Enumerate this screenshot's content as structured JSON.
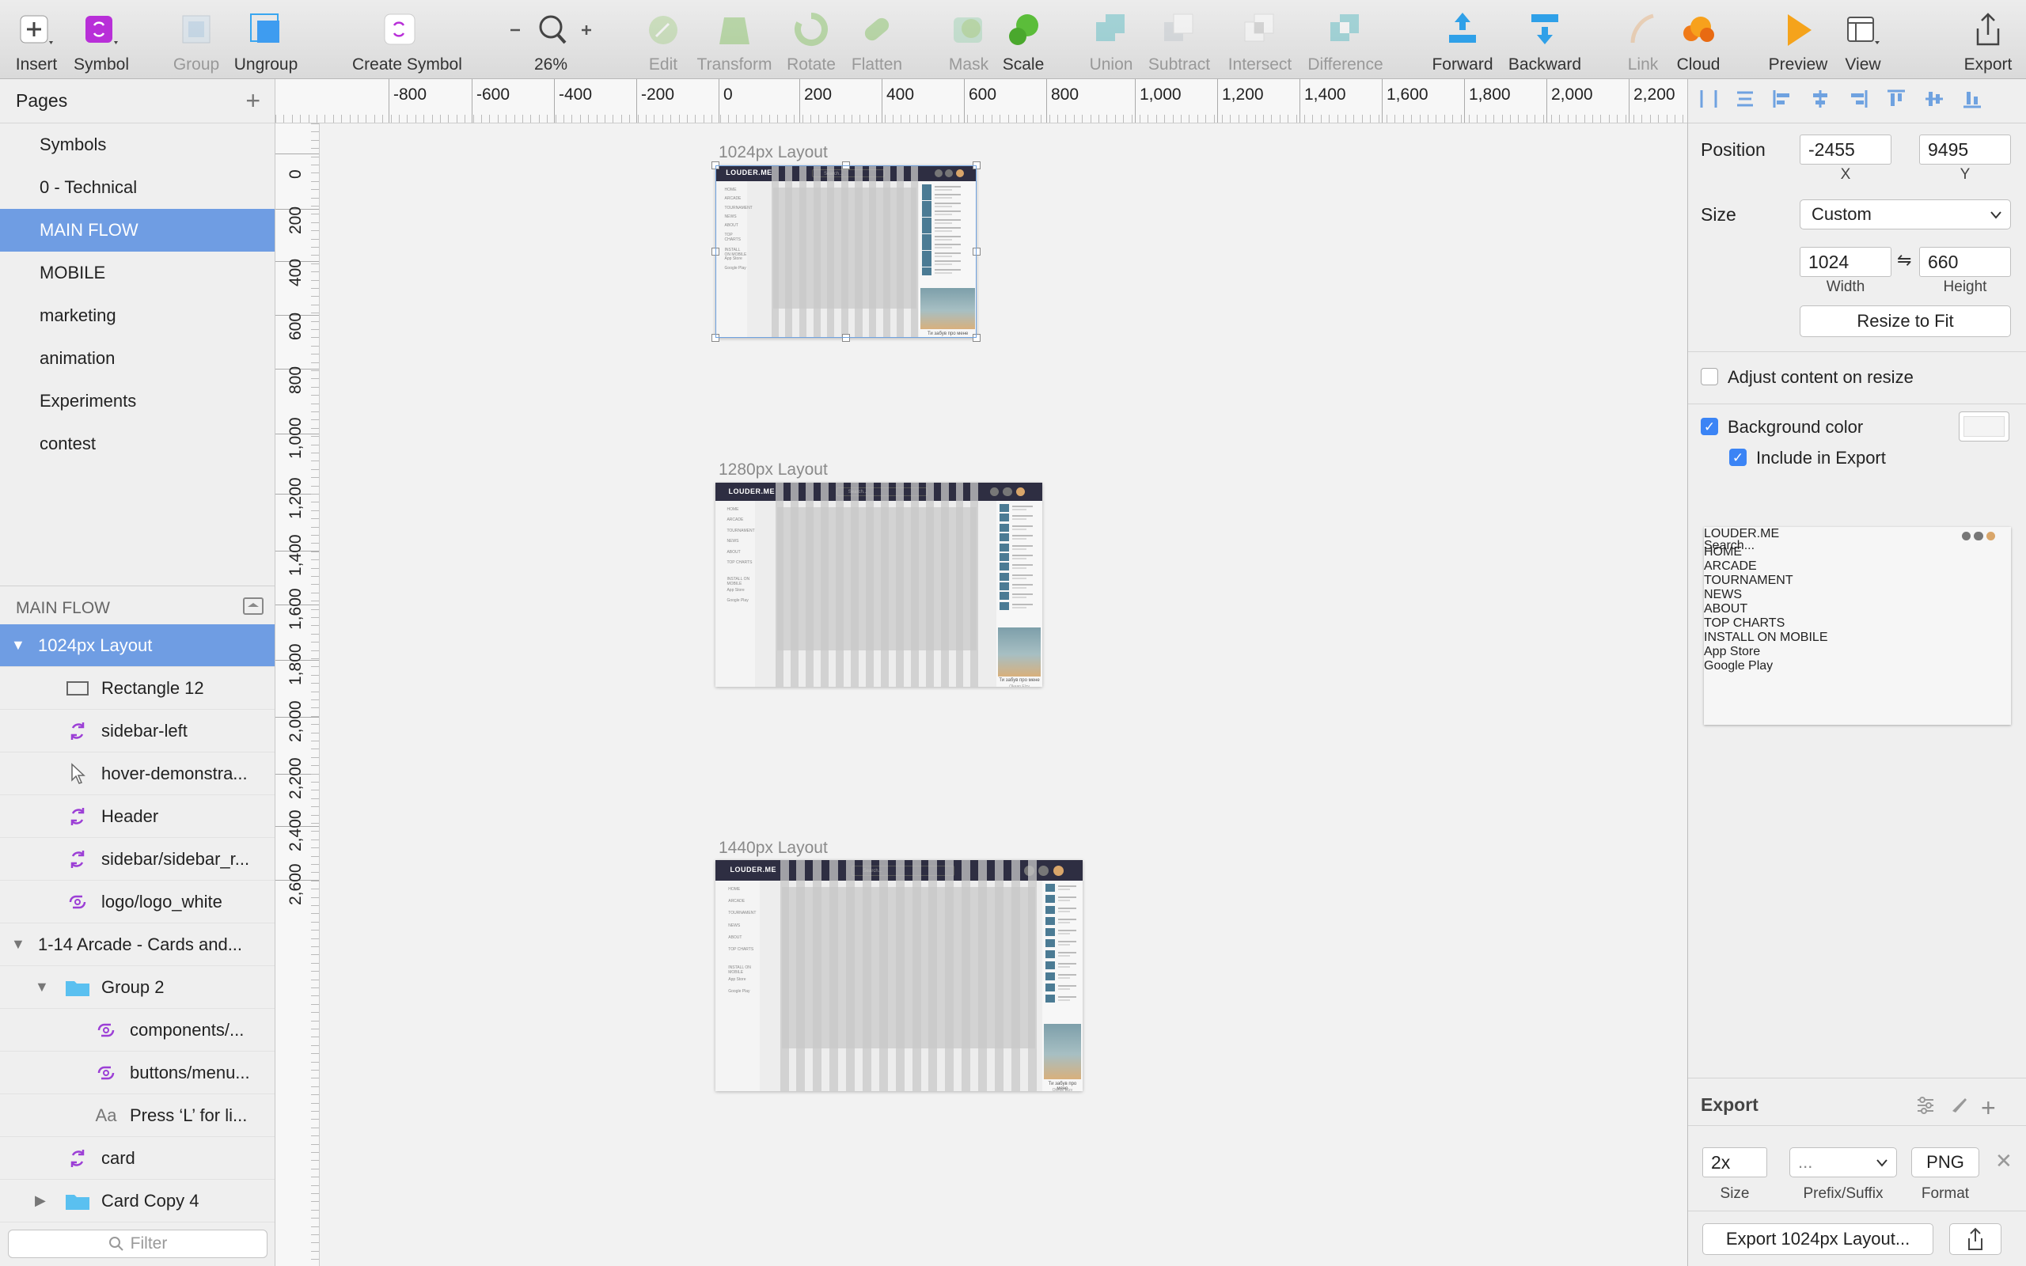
{
  "toolbar": {
    "insert": "Insert",
    "symbol": "Symbol",
    "group": "Group",
    "ungroup": "Ungroup",
    "create_symbol": "Create Symbol",
    "zoom": "26%",
    "edit": "Edit",
    "transform": "Transform",
    "rotate": "Rotate",
    "flatten": "Flatten",
    "mask": "Mask",
    "scale": "Scale",
    "union": "Union",
    "subtract": "Subtract",
    "intersect": "Intersect",
    "difference": "Difference",
    "forward": "Forward",
    "backward": "Backward",
    "link": "Link",
    "cloud": "Cloud",
    "preview": "Preview",
    "view": "View",
    "export": "Export"
  },
  "pages": {
    "title": "Pages",
    "items": [
      "Symbols",
      "0 - Technical",
      "MAIN FLOW",
      "MOBILE",
      "marketing",
      "animation",
      "Experiments",
      "contest"
    ],
    "selected": "MAIN FLOW"
  },
  "layers": {
    "title": "MAIN FLOW",
    "items": [
      {
        "label": "1024px Layout",
        "icon": "artboard-triangle-icon",
        "selected": true
      },
      {
        "label": "Rectangle 12",
        "icon": "rectangle-icon"
      },
      {
        "label": "sidebar-left",
        "icon": "symbol-instance-icon"
      },
      {
        "label": "hover-demonstra...",
        "icon": "cursor-icon"
      },
      {
        "label": "Header",
        "icon": "symbol-instance-icon"
      },
      {
        "label": "sidebar/sidebar_r...",
        "icon": "symbol-instance-icon"
      },
      {
        "label": "logo/logo_white",
        "icon": "library-symbol-icon"
      },
      {
        "label": "1-14 Arcade - Cards and...",
        "icon": "artboard-triangle-icon"
      },
      {
        "label": "Group 2",
        "icon": "folder-icon"
      },
      {
        "label": "components/...",
        "icon": "library-symbol-icon"
      },
      {
        "label": "buttons/menu...",
        "icon": "library-symbol-icon"
      },
      {
        "label": "Press ‘L’ for li...",
        "icon": "text-layer-icon"
      },
      {
        "label": "card",
        "icon": "symbol-instance-icon"
      },
      {
        "label": "Card Copy 4",
        "icon": "folder-icon"
      }
    ],
    "filter_placeholder": "Filter"
  },
  "ruler_h": [
    "-800",
    "-600",
    "-400",
    "-200",
    "0",
    "200",
    "400",
    "600",
    "800",
    "1,000",
    "1,200",
    "1,400",
    "1,600",
    "1,800",
    "2,000",
    "2,200"
  ],
  "ruler_v": [
    "0",
    "200",
    "400",
    "600",
    "800",
    "1,000",
    "1,200",
    "1,400",
    "1,600",
    "1,800",
    "2,000",
    "2,200",
    "2,400",
    "2,600"
  ],
  "artboards": [
    {
      "title": "1024px Layout"
    },
    {
      "title": "1280px Layout"
    },
    {
      "title": "1440px Layout"
    }
  ],
  "artboard_content": {
    "logo": "LOUDER.ME",
    "search": "Search...",
    "nav": [
      "HOME",
      "ARCADE",
      "TOURNAMENT",
      "NEWS",
      "ABOUT",
      "TOP CHARTS",
      "INSTALL ON MOBILE",
      "App Store",
      "Google Play"
    ],
    "player_title": "Ти забув про мене",
    "player_artist": "Okean Elzy"
  },
  "inspector": {
    "position_label": "Position",
    "x": "-2455",
    "y": "9495",
    "x_label": "X",
    "y_label": "Y",
    "size_label": "Size",
    "size_preset": "Custom",
    "width": "1024",
    "height": "660",
    "width_label": "Width",
    "height_label": "Height",
    "resize_to_fit": "Resize to Fit",
    "adjust_content": "Adjust content on resize",
    "adjust_content_checked": false,
    "background_color": "Background color",
    "background_color_checked": true,
    "include_in_export": "Include in Export",
    "include_in_export_checked": true,
    "swatch_color": "#f4f4f4"
  },
  "export": {
    "title": "Export",
    "scale": "2x",
    "prefix": "...",
    "format": "PNG",
    "scale_label": "Size",
    "prefix_label": "Prefix/Suffix",
    "format_label": "Format",
    "export_button": "Export 1024px Layout..."
  }
}
